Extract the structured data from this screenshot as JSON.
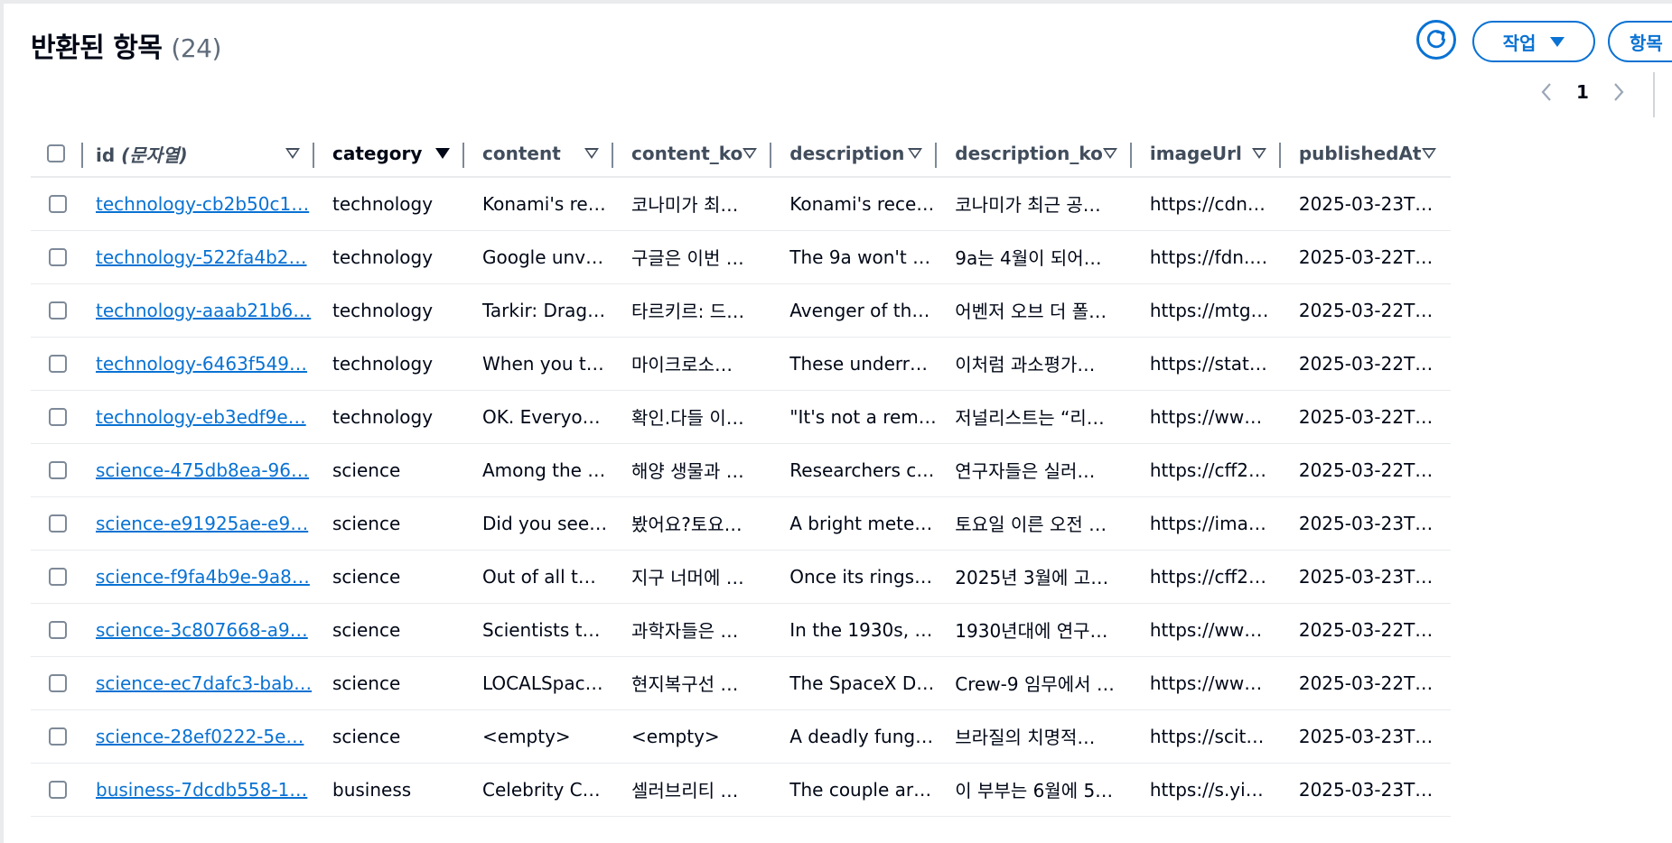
{
  "header": {
    "title": "반환된 항목",
    "count": "(24)"
  },
  "toolbar": {
    "actions_label": "작업",
    "items_label": "항목"
  },
  "pagination": {
    "current_page": "1"
  },
  "columns": [
    {
      "label": "id",
      "suffix": " (문자열)",
      "sort": "none"
    },
    {
      "label": "category",
      "sort": "active"
    },
    {
      "label": "content",
      "sort": "none"
    },
    {
      "label": "content_ko",
      "sort": "none"
    },
    {
      "label": "description",
      "sort": "none"
    },
    {
      "label": "description_ko",
      "sort": "none"
    },
    {
      "label": "imageUrl",
      "sort": "none"
    },
    {
      "label": "publishedAt",
      "sort": "none"
    }
  ],
  "rows": [
    {
      "id": "technology-cb2b50c1…",
      "category": "technology",
      "content": "Konami's re…",
      "content_ko": "코나미가 최…",
      "description": "Konami's rece…",
      "description_ko": "코나미가 최근 공…",
      "imageUrl": "https://cdn…",
      "publishedAt": "2025-03-23T…"
    },
    {
      "id": "technology-522fa4b2…",
      "category": "technology",
      "content": "Google unv…",
      "content_ko": "구글은 이번 …",
      "description": "The 9a won't …",
      "description_ko": "9a는 4월이 되어…",
      "imageUrl": "https://fdn.…",
      "publishedAt": "2025-03-22T…"
    },
    {
      "id": "technology-aaab21b6…",
      "category": "technology",
      "content": "Tarkir: Drag…",
      "content_ko": "타르키르: 드…",
      "description": "Avenger of th…",
      "description_ko": "어벤저 오브 더 폴…",
      "imageUrl": "https://mtg…",
      "publishedAt": "2025-03-22T…"
    },
    {
      "id": "technology-6463f549…",
      "category": "technology",
      "content": "When you t…",
      "content_ko": "마이크로소…",
      "description": "These underr…",
      "description_ko": "이처럼 과소평가…",
      "imageUrl": "https://stat…",
      "publishedAt": "2025-03-22T…"
    },
    {
      "id": "technology-eb3edf9e…",
      "category": "technology",
      "content": "OK. Everyo…",
      "content_ko": "확인.다들 이…",
      "description": "\"It's not a rem…",
      "description_ko": "저널리스트는 “리…",
      "imageUrl": "https://ww…",
      "publishedAt": "2025-03-22T…"
    },
    {
      "id": "science-475db8ea-96…",
      "category": "science",
      "content": "Among the …",
      "content_ko": "해양 생물과 …",
      "description": "Researchers cl…",
      "description_ko": "연구자들은 실러…",
      "imageUrl": "https://cff2…",
      "publishedAt": "2025-03-22T…"
    },
    {
      "id": "science-e91925ae-e9…",
      "category": "science",
      "content": "Did you see…",
      "content_ko": "봤어요?토요…",
      "description": "A bright mete…",
      "description_ko": "토요일 이른 오전 …",
      "imageUrl": "https://ima…",
      "publishedAt": "2025-03-23T…"
    },
    {
      "id": "science-f9fa4b9e-9a8…",
      "category": "science",
      "content": "Out of all t…",
      "content_ko": "지구 너머에 …",
      "description": "Once its rings …",
      "description_ko": "2025년 3월에 고…",
      "imageUrl": "https://cff2…",
      "publishedAt": "2025-03-23T…"
    },
    {
      "id": "science-3c807668-a9…",
      "category": "science",
      "content": "Scientists t…",
      "content_ko": "과학자들은 …",
      "description": "In the 1930s, …",
      "description_ko": "1930년대에 연구…",
      "imageUrl": "https://ww…",
      "publishedAt": "2025-03-22T…"
    },
    {
      "id": "science-ec7dafc3-bab…",
      "category": "science",
      "content": "LOCALSpac…",
      "content_ko": "현지복구선 …",
      "description": "The SpaceX D…",
      "description_ko": "Crew-9 임무에서 …",
      "imageUrl": "https://ww…",
      "publishedAt": "2025-03-22T…"
    },
    {
      "id": "science-28ef0222-5e…",
      "category": "science",
      "content": "<empty>",
      "content_ko": "<empty>",
      "description": "A deadly fung…",
      "description_ko": "브라질의 치명적…",
      "imageUrl": "https://scit…",
      "publishedAt": "2025-03-23T…"
    },
    {
      "id": "business-7dcdb558-1…",
      "category": "business",
      "content": "Celebrity C…",
      "content_ko": "셀러브리티 …",
      "description": "The couple ar…",
      "description_ko": "이 부부는 6월에 5…",
      "imageUrl": "https://s.yi…",
      "publishedAt": "2025-03-23T…"
    }
  ]
}
